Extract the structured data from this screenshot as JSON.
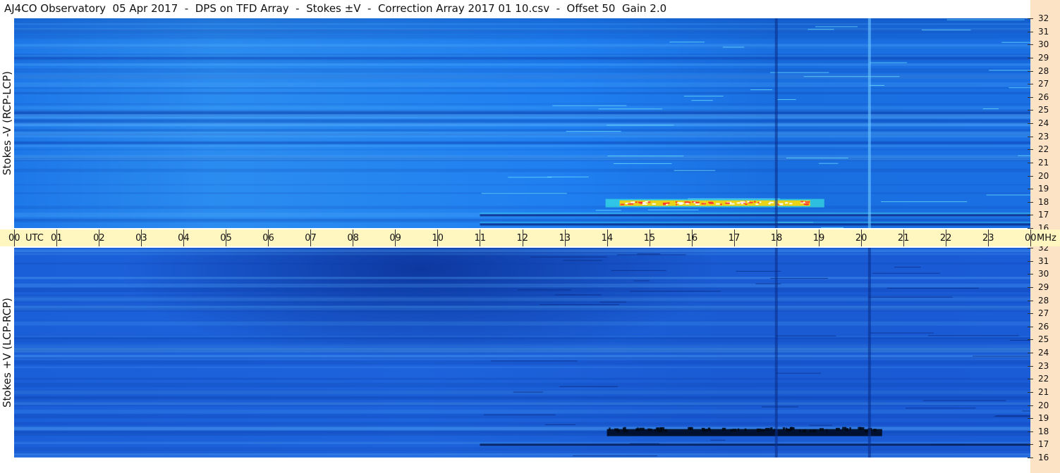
{
  "title": "AJ4CO Observatory  05 Apr 2017  -  DPS on TFD Array  -  Stokes ±V  -  Correction Array 2017 01 10.csv  -  Offset 50  Gain 2.0",
  "panels": {
    "top": {
      "ylabel": "Stokes -V (RCP-LCP)"
    },
    "bottom": {
      "ylabel": "Stokes +V (LCP-RCP)"
    }
  },
  "time_axis": {
    "labels": [
      "00",
      "01",
      "02",
      "03",
      "04",
      "05",
      "06",
      "07",
      "08",
      "09",
      "10",
      "11",
      "12",
      "13",
      "14",
      "15",
      "16",
      "17",
      "18",
      "19",
      "20",
      "21",
      "22",
      "23",
      "00"
    ],
    "unit": "UTC",
    "freq_unit": "MHz"
  },
  "freq_axis": {
    "labels": [
      "32",
      "31",
      "30",
      "29",
      "28",
      "27",
      "26",
      "25",
      "24",
      "23",
      "22",
      "21",
      "20",
      "19",
      "18",
      "17",
      "16"
    ]
  },
  "colors": {
    "background_blue": "#1f7ff0",
    "burst_hot": "#ff3030",
    "burst_warm": "#ffd400",
    "burst_cyan": "#40ffe0",
    "axis_band": "#fff6c0",
    "right_axis": "#fde3c6"
  },
  "chart_data": {
    "type": "heatmap",
    "title": "AJ4CO Observatory  05 Apr 2017  -  DPS on TFD Array  -  Stokes ±V  -  Correction Array 2017 01 10.csv  -  Offset 50  Gain 2.0",
    "xlabel": "UTC",
    "ylabel_right": "MHz",
    "x_range": [
      0,
      24
    ],
    "y_range": [
      16,
      32
    ],
    "panels": [
      {
        "name": "Stokes -V (RCP-LCP)",
        "features": [
          {
            "kind": "burst",
            "x_start": 14.3,
            "x_end": 18.8,
            "y": 17.9,
            "intensity": "high"
          },
          {
            "kind": "line",
            "x_start": 11.0,
            "x_end": 24.0,
            "y": 17.0,
            "intensity": "medium"
          },
          {
            "kind": "line",
            "x_start": 11.0,
            "x_end": 24.0,
            "y": 16.3,
            "intensity": "low"
          },
          {
            "kind": "vertical",
            "x": 18.0,
            "y_start": 16,
            "y_end": 32,
            "intensity": "dark"
          },
          {
            "kind": "vertical",
            "x": 20.2,
            "y_start": 16,
            "y_end": 32,
            "intensity": "light"
          }
        ]
      },
      {
        "name": "Stokes +V (LCP-RCP)",
        "features": [
          {
            "kind": "burst",
            "x_start": 14.0,
            "x_end": 20.5,
            "y": 17.9,
            "intensity": "dark"
          },
          {
            "kind": "line",
            "x_start": 11.0,
            "x_end": 24.0,
            "y": 17.0,
            "intensity": "dark"
          },
          {
            "kind": "vertical",
            "x": 18.0,
            "y_start": 16,
            "y_end": 32,
            "intensity": "dark"
          },
          {
            "kind": "vertical",
            "x": 20.2,
            "y_start": 16,
            "y_end": 32,
            "intensity": "dark"
          }
        ]
      }
    ]
  }
}
